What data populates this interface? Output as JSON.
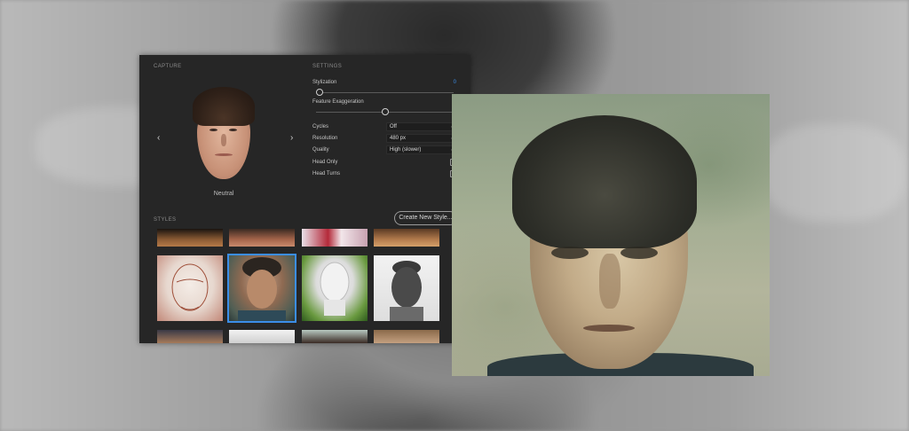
{
  "capture": {
    "section_label": "CAPTURE",
    "expression_label": "Neutral",
    "prev_arrow": "‹",
    "next_arrow": "›"
  },
  "settings": {
    "section_label": "SETTINGS",
    "stylization": {
      "label": "Stylization",
      "value": "0",
      "fraction": 0.0
    },
    "feature_exaggeration": {
      "label": "Feature Exaggeration",
      "value": "0",
      "fraction": 0.5
    },
    "cycles": {
      "label": "Cycles",
      "value": "Off"
    },
    "resolution": {
      "label": "Resolution",
      "value": "480 px"
    },
    "quality": {
      "label": "Quality",
      "value": "High (slower)"
    },
    "head_only": {
      "label": "Head Only",
      "checked": false
    },
    "head_turns": {
      "label": "Head Turns",
      "checked": false
    }
  },
  "styles": {
    "section_label": "STYLES",
    "create_button": "Create New Style...",
    "selected_index": 5,
    "thumbnails": [
      {
        "name": "bronze-sculpture"
      },
      {
        "name": "red-hair-painting"
      },
      {
        "name": "pop-portrait"
      },
      {
        "name": "wood-carving"
      },
      {
        "name": "red-chalk-sketch"
      },
      {
        "name": "oil-painting-man"
      },
      {
        "name": "white-bust"
      },
      {
        "name": "pencil-drawing"
      },
      {
        "name": "partial-style-1"
      },
      {
        "name": "partial-style-2"
      },
      {
        "name": "partial-style-3"
      },
      {
        "name": "partial-style-4"
      }
    ]
  },
  "colors": {
    "accent": "#3b8ee8",
    "panel_bg": "#262626"
  }
}
